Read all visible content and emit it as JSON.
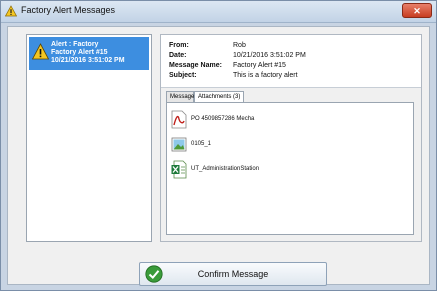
{
  "window": {
    "title": "Factory Alert Messages",
    "close_label": "✕"
  },
  "alerts": [
    {
      "line1": "Alert : Factory",
      "line2": "Factory Alert #15",
      "line3": "10/21/2016 3:51:02 PM"
    }
  ],
  "message": {
    "from_label": "From:",
    "from_value": "Rob",
    "date_label": "Date:",
    "date_value": "10/21/2016 3:51:02 PM",
    "name_label": "Message Name:",
    "name_value": "Factory Alert #15",
    "subject_label": "Subject:",
    "subject_value": "This is a factory alert"
  },
  "tabs": [
    {
      "label": "Message",
      "active": false
    },
    {
      "label": "Attachments (3)",
      "active": true
    }
  ],
  "attachments": [
    {
      "name": "PO 4509857286 Mecha",
      "icon": "pdf-icon"
    },
    {
      "name": "0105_1",
      "icon": "image-file-icon"
    },
    {
      "name": "UT_AdministrationStation",
      "icon": "excel-icon"
    }
  ],
  "confirm_button": {
    "label": "Confirm Message",
    "icon": "checkmark-icon"
  }
}
